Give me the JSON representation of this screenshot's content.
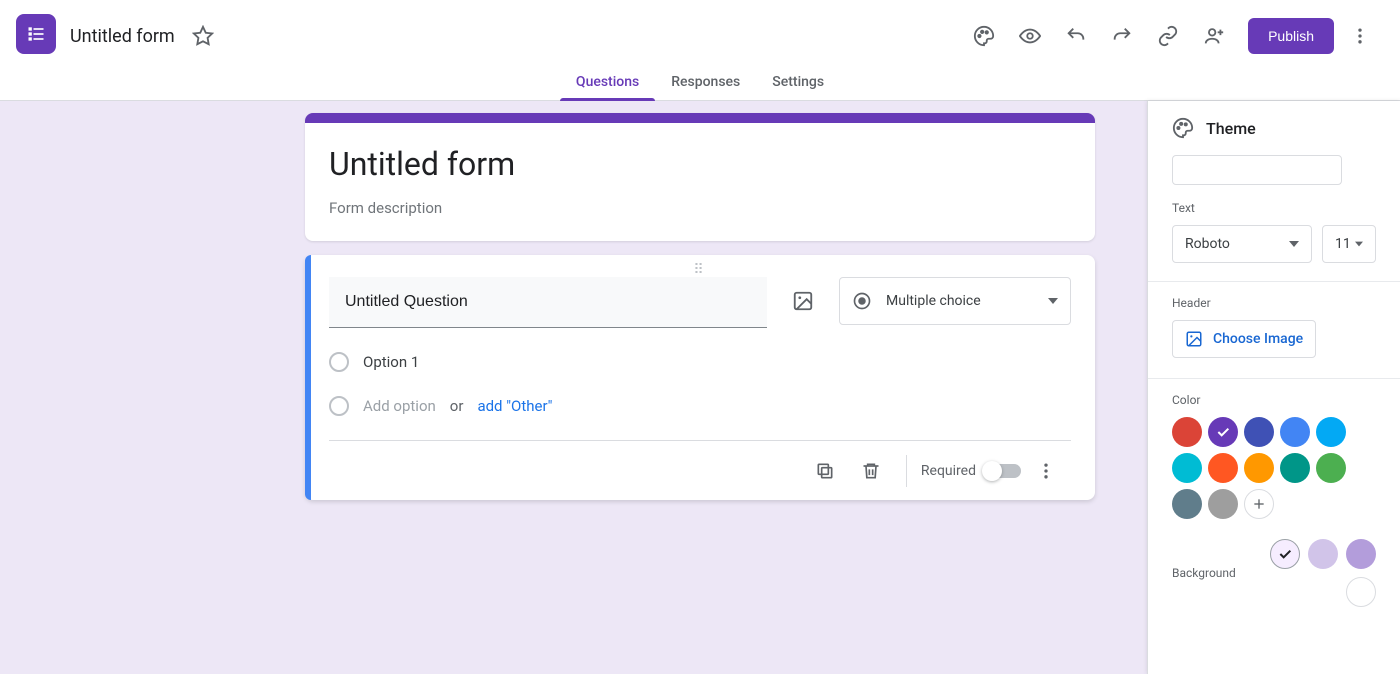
{
  "header": {
    "title": "Untitled form",
    "publish_label": "Publish"
  },
  "tabs": [
    {
      "label": "Questions",
      "active": true
    },
    {
      "label": "Responses",
      "active": false
    },
    {
      "label": "Settings",
      "active": false
    }
  ],
  "form": {
    "title": "Untitled form",
    "description_placeholder": "Form description"
  },
  "question": {
    "title": "Untitled Question",
    "type_label": "Multiple choice",
    "options": [
      {
        "label": "Option 1"
      }
    ],
    "add_option_label": "Add option",
    "or_label": "or",
    "add_other_label": "add \"Other\"",
    "required_label": "Required",
    "required": false
  },
  "theme": {
    "panel_title": "Theme",
    "text_section_label": "Text",
    "text_font": "Roboto",
    "text_size": "11",
    "header_section_label": "Header",
    "choose_image_label": "Choose Image",
    "color_section_label": "Color",
    "colors": [
      {
        "hex": "#db4437",
        "selected": false
      },
      {
        "hex": "#673ab7",
        "selected": true
      },
      {
        "hex": "#3f51b5",
        "selected": false
      },
      {
        "hex": "#4285f4",
        "selected": false
      },
      {
        "hex": "#03a9f4",
        "selected": false
      },
      {
        "hex": "#00bcd4",
        "selected": false
      },
      {
        "hex": "#ff5722",
        "selected": false
      },
      {
        "hex": "#ff9800",
        "selected": false
      },
      {
        "hex": "#009688",
        "selected": false
      },
      {
        "hex": "#4caf50",
        "selected": false
      },
      {
        "hex": "#607d8b",
        "selected": false
      },
      {
        "hex": "#9e9e9e",
        "selected": false
      }
    ],
    "background_label": "Background",
    "backgrounds": [
      {
        "hex": "#f6edff",
        "selected": true
      },
      {
        "hex": "#d1c4e9",
        "selected": false
      },
      {
        "hex": "#b39ddb",
        "selected": false
      },
      {
        "hex": "#ffffff",
        "selected": false
      }
    ]
  }
}
